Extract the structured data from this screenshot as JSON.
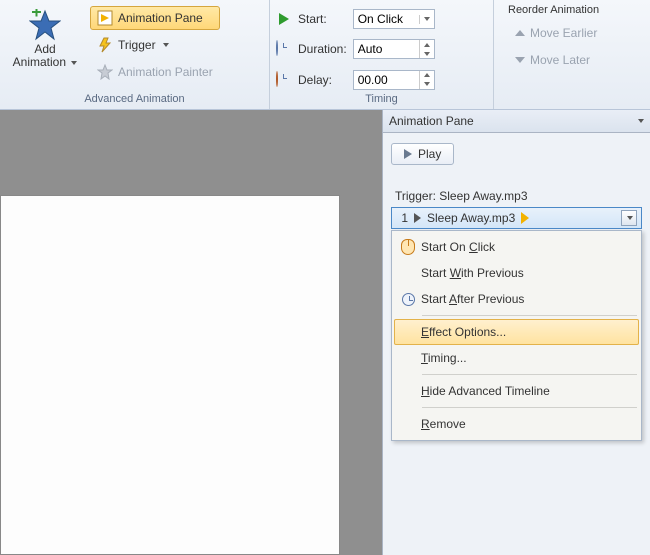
{
  "ribbon": {
    "add_animation": "Add\nAnimation",
    "animation_pane": "Animation Pane",
    "trigger": "Trigger",
    "animation_painter": "Animation Painter",
    "group_advanced": "Advanced Animation",
    "start_label": "Start:",
    "start_value": "On Click",
    "duration_label": "Duration:",
    "duration_value": "Auto",
    "delay_label": "Delay:",
    "delay_value": "00.00",
    "group_timing": "Timing",
    "reorder_header": "Reorder Animation",
    "move_earlier": "Move Earlier",
    "move_later": "Move Later"
  },
  "pane": {
    "title": "Animation Pane",
    "play": "Play",
    "trigger_label": "Trigger: Sleep Away.mp3",
    "item_number": "1",
    "item_name": "Sleep Away.mp3"
  },
  "menu": {
    "start_on_click": "Start On Click",
    "start_with_previous": "Start With Previous",
    "start_after_previous": "Start After Previous",
    "effect_options": "Effect Options...",
    "timing": "Timing...",
    "hide_timeline": "Hide Advanced Timeline",
    "remove": "Remove"
  },
  "underline": {
    "start_on_click": "C",
    "start_with_previous": "W",
    "start_after_previous": "A",
    "effect_options": "E",
    "timing": "T",
    "hide_timeline": "H",
    "remove": "R"
  }
}
